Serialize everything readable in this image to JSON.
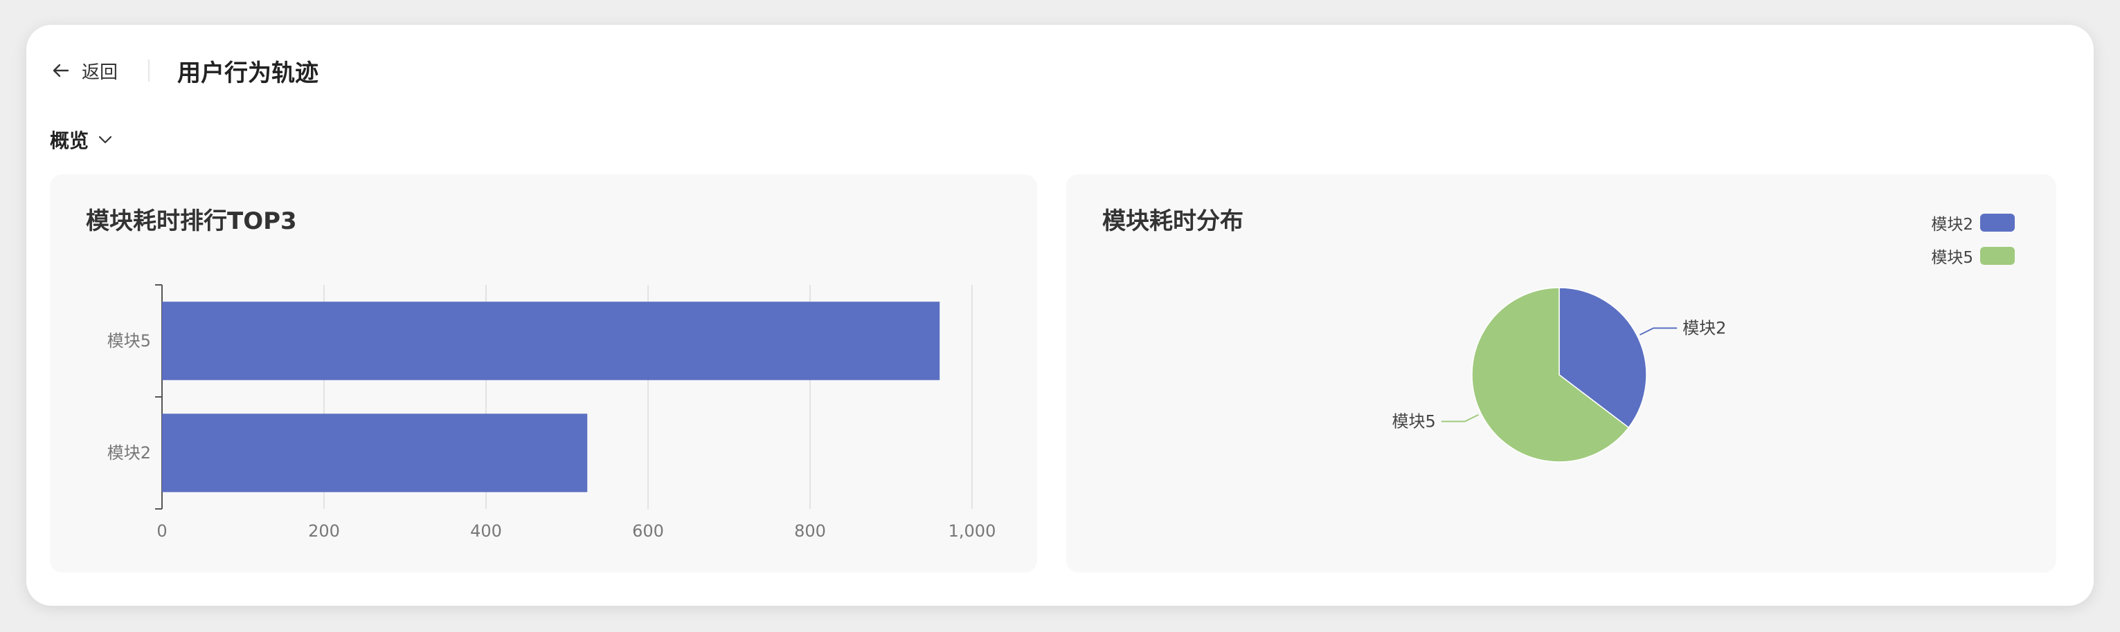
{
  "header": {
    "back_label": "返回",
    "title": "用户行为轨迹"
  },
  "section": {
    "label": "概览"
  },
  "colors": {
    "series_blue": "#5B70C2",
    "series_green": "#A0CA7E"
  },
  "chart_data": [
    {
      "type": "bar",
      "orientation": "horizontal",
      "title": "模块耗时排行TOP3",
      "categories": [
        "模块5",
        "模块2"
      ],
      "values": [
        960,
        525
      ],
      "xlim": [
        0,
        1000
      ],
      "x_ticks": [
        "0",
        "200",
        "400",
        "600",
        "800",
        "1,000"
      ],
      "grid": "vertical",
      "color": "#5B70C2"
    },
    {
      "type": "pie",
      "title": "模块耗时分布",
      "slices": [
        {
          "label": "模块2",
          "value": 525,
          "color": "#5B70C2"
        },
        {
          "label": "模块5",
          "value": 960,
          "color": "#A0CA7E"
        }
      ],
      "legend": {
        "position": "top-right",
        "items": [
          {
            "label": "模块2",
            "color": "#5B70C2"
          },
          {
            "label": "模块5",
            "color": "#A0CA7E"
          }
        ]
      }
    }
  ]
}
